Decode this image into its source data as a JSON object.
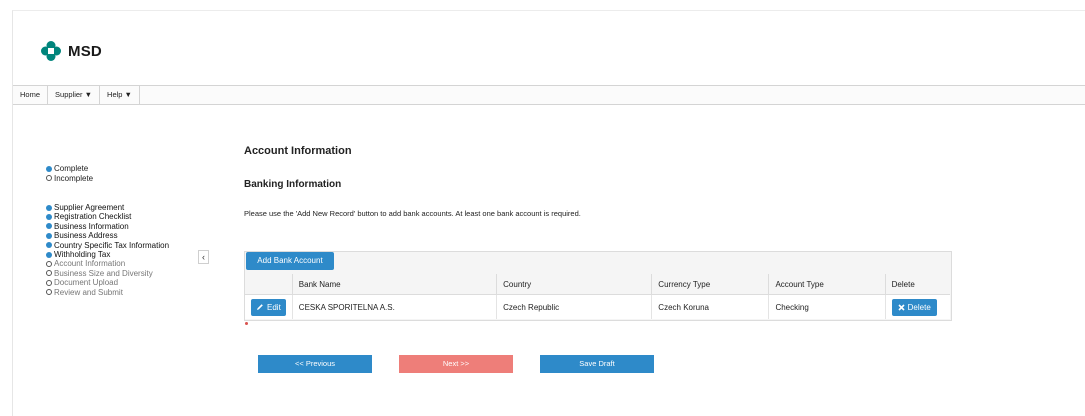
{
  "brand": {
    "name": "MSD",
    "color": "#00857c"
  },
  "nav": {
    "items": [
      "Home",
      "Supplier ▼",
      "Help ▼"
    ]
  },
  "legend": {
    "complete": "Complete",
    "incomplete": "Incomplete"
  },
  "steps": [
    {
      "label": "Supplier Agreement",
      "status": "complete"
    },
    {
      "label": "Registration Checklist",
      "status": "complete"
    },
    {
      "label": "Business Information",
      "status": "complete"
    },
    {
      "label": "Business Address",
      "status": "complete"
    },
    {
      "label": "Country Specific Tax Information",
      "status": "complete"
    },
    {
      "label": "Withholding Tax",
      "status": "complete"
    },
    {
      "label": "Account Information",
      "status": "incomplete"
    },
    {
      "label": "Business Size and Diversity",
      "status": "incomplete"
    },
    {
      "label": "Document Upload",
      "status": "incomplete"
    },
    {
      "label": "Review and Submit",
      "status": "incomplete"
    }
  ],
  "collapse_glyph": "‹",
  "main": {
    "title": "Account Information",
    "subtitle": "Banking Information",
    "note": "Please use the 'Add New Record' button to add bank accounts. At least one bank account is required.",
    "add_button": "Add Bank Account",
    "table": {
      "headers": [
        "",
        "Bank Name",
        "Country",
        "Currency Type",
        "Account Type",
        "Delete"
      ],
      "rows": [
        {
          "edit": "Edit",
          "bank_name": "CESKA SPORITELNA A.S.",
          "country": "Czech Republic",
          "currency": "Czech Koruna",
          "account_type": "Checking",
          "delete": "Delete"
        }
      ]
    },
    "required_mark": "*"
  },
  "buttons": {
    "previous": "<< Previous",
    "next": "Next >>",
    "save_draft": "Save Draft"
  },
  "colors": {
    "primary": "#2e8ac9",
    "next": "#ee7e79",
    "complete_dot": "#2e8ac9"
  }
}
